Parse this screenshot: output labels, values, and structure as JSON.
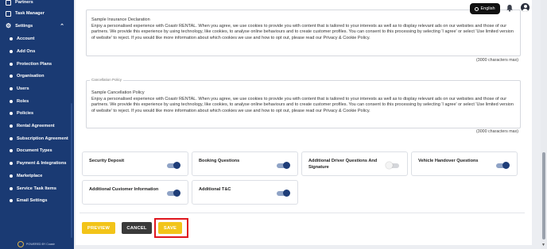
{
  "sidebar": {
    "partners": "Partners",
    "task_manager": "Task Manager",
    "settings": "Settings",
    "items": [
      {
        "label": "Account"
      },
      {
        "label": "Add Ons"
      },
      {
        "label": "Protection Plans"
      },
      {
        "label": "Organisation"
      },
      {
        "label": "Users"
      },
      {
        "label": "Roles"
      },
      {
        "label": "Policies"
      },
      {
        "label": "Rental Agreement"
      },
      {
        "label": "Subscription Agreement"
      },
      {
        "label": "Document Types"
      },
      {
        "label": "Payment & Integrations"
      },
      {
        "label": "Marketplace"
      },
      {
        "label": "Service Task Items"
      },
      {
        "label": "Email Settings"
      }
    ],
    "powered_by": "POWERED BY Coastr"
  },
  "topbar": {
    "language": "English"
  },
  "insurance": {
    "title": "Sample Insurance Declaration",
    "body": "Enjoy a personalised experience with Coastr RENTAL. When you agree, we use cookies to provide you with content that is tailored to your interests as well as to display relevant ads on our websites and those of our partners. We provide this experience by using technology, like cookies, to analyse online behaviours and to create customer profiles. You can consent to this processing by selecting 'I agree' or select 'Use limited version of website' to reject. If you would like more information about which cookies we use and how to opt out, please read our Privacy & Cookie Policy.",
    "limit": "(3000 characters max)"
  },
  "cancellation": {
    "legend": "Cancellation Policy",
    "title": "Sample Cancellation Policy",
    "body": "Enjoy a personalised experience with Coastr RENTAL. When you agree, we use cookies to provide you with content that is tailored to your interests as well as to display relevant ads on our websites and those of our partners. We provide this experience by using technology, like cookies, to analyse online behaviours and to create customer profiles. You can consent to this processing by selecting 'I agree' or select 'Use limited version of website' to reject. If you would like more information about which cookies we use and how to opt out, please read our Privacy & Cookie Policy.",
    "limit": "(3000 characters max)"
  },
  "toggles": [
    {
      "label": "Security Deposit",
      "on": true
    },
    {
      "label": "Booking Questions",
      "on": true
    },
    {
      "label": "Additional Driver Questions And Signature",
      "on": false
    },
    {
      "label": "Vehicle Handover Questions",
      "on": true
    },
    {
      "label": "Additional Customer Information",
      "on": true
    },
    {
      "label": "Additional T&C",
      "on": true
    }
  ],
  "colors": {
    "sidebar": "#1a3a73",
    "accent_yellow": "#f2c419",
    "toggle_on": "#1e3d78",
    "highlight_red": "#e0161e"
  },
  "actions": {
    "preview": "PREVIEW",
    "cancel": "CANCEL",
    "save": "SAVE"
  }
}
